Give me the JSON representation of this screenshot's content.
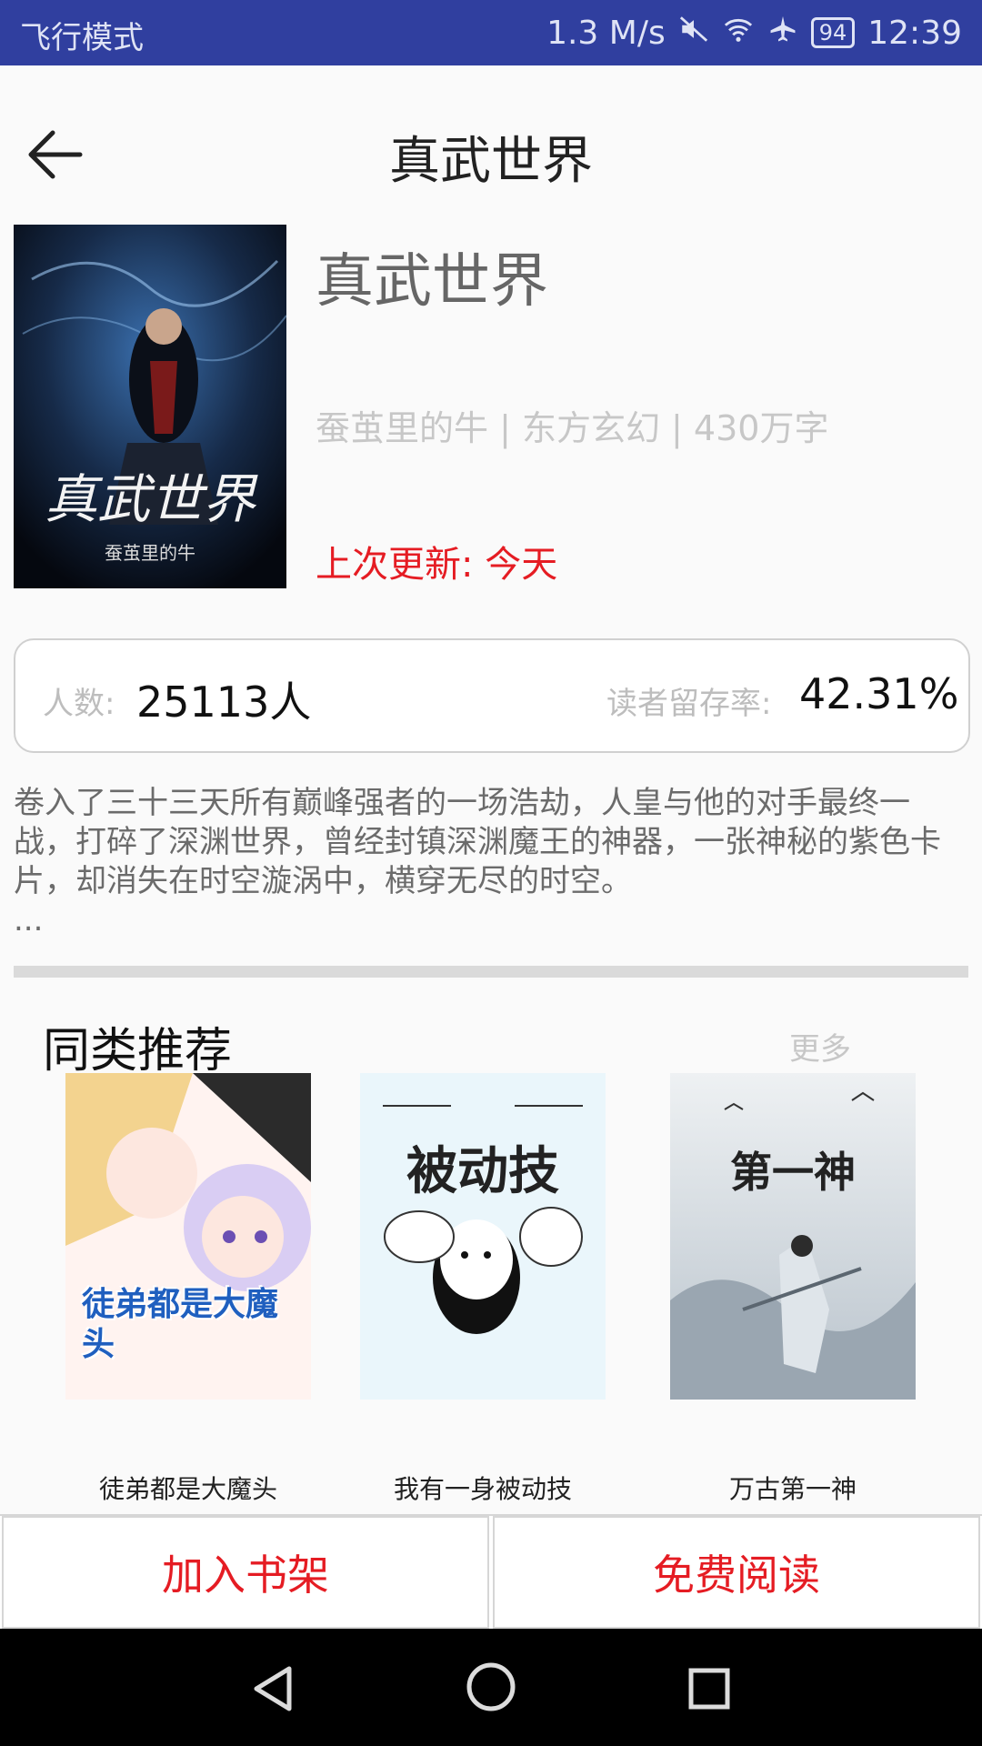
{
  "status_bar": {
    "mode_text": "飞行模式",
    "speed": "1.3 M/s",
    "battery": "94",
    "time": "12:39"
  },
  "header": {
    "title": "真武世界"
  },
  "book": {
    "title": "真武世界",
    "meta": "蚕茧里的牛 | 东方玄幻 | 430万字",
    "last_update": "上次更新: 今天",
    "cover_text": "真武世界",
    "cover_author": "蚕茧里的牛"
  },
  "stats": {
    "readers_label": "人数:",
    "readers_value": "25113人",
    "retention_label": "读者留存率:",
    "retention_value": "42.31%"
  },
  "description": {
    "text": "卷入了三十三天所有巅峰强者的一场浩劫，人皇与他的对手最终一战，打碎了深渊世界，曾经封镇深渊魔王的神器，一张神秘的紫色卡片，却消失在时空漩涡中，横穿无尽的时空。",
    "ellipsis": "..."
  },
  "recommendations": {
    "title": "同类推荐",
    "more": "更多",
    "items": [
      {
        "name": "徒弟都是大魔头",
        "cover_text": "徒弟都是大魔头"
      },
      {
        "name": "我有一身被动技",
        "cover_text": "被动技"
      },
      {
        "name": "万古第一神",
        "cover_text": "第一神"
      }
    ]
  },
  "actions": {
    "add_shelf": "加入书架",
    "read_free": "免费阅读"
  },
  "colors": {
    "status_bar": "#303f9f",
    "accent_red": "#e51c23"
  }
}
